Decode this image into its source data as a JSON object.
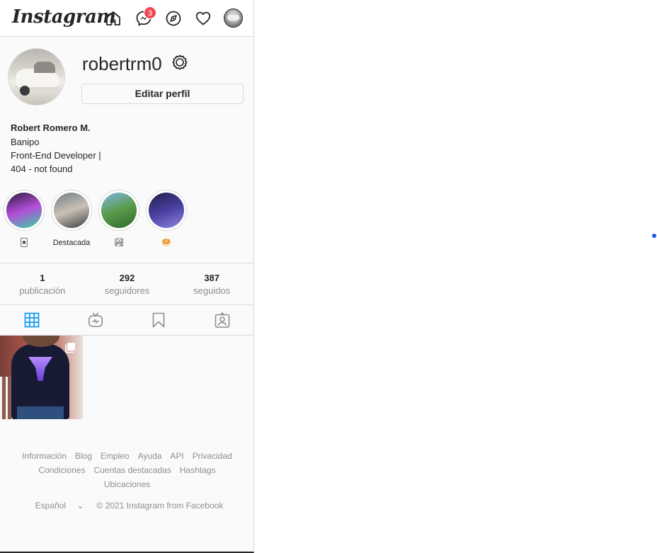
{
  "app": {
    "brand": "Instagram"
  },
  "nav": {
    "icons": [
      "home-icon",
      "messenger-icon",
      "explore-icon",
      "activity-heart-icon",
      "profile-avatar"
    ],
    "messages_badge": "3"
  },
  "profile": {
    "username": "robertrm0",
    "edit_label": "Editar perfil",
    "full_name": "Robert Romero M.",
    "bio_lines": [
      "Banipo",
      "Front-End Developer |",
      "404 - not found"
    ]
  },
  "highlights": [
    {
      "label": "🃏",
      "colors": [
        "#2b1a3d",
        "#b44ed8",
        "#35d4a0"
      ]
    },
    {
      "label": "Destacada",
      "colors": [
        "#6f7e88",
        "#c9c1b5",
        "#3a3d3f"
      ]
    },
    {
      "label": "🏞",
      "colors": [
        "#7fb6e6",
        "#5a9a4a",
        "#2f6a2e"
      ]
    },
    {
      "label": "🥯",
      "colors": [
        "#1e2048",
        "#4a3fa0",
        "#8f86e0"
      ]
    }
  ],
  "stats": [
    {
      "value": "1",
      "label": "publicación"
    },
    {
      "value": "292",
      "label": "seguidores"
    },
    {
      "value": "387",
      "label": "seguidos"
    }
  ],
  "tabs": [
    "posts-grid-icon",
    "igtv-icon",
    "saved-icon",
    "tagged-icon"
  ],
  "accent_color": "#0095f6",
  "footer": {
    "links_row1": [
      "Información",
      "Blog",
      "Empleo",
      "Ayuda",
      "API",
      "Privacidad"
    ],
    "links_row2": [
      "Condiciones",
      "Cuentas destacadas",
      "Hashtags"
    ],
    "links_row3": [
      "Ubicaciones"
    ],
    "language": "Español",
    "copyright": "© 2021 Instagram from Facebook"
  }
}
